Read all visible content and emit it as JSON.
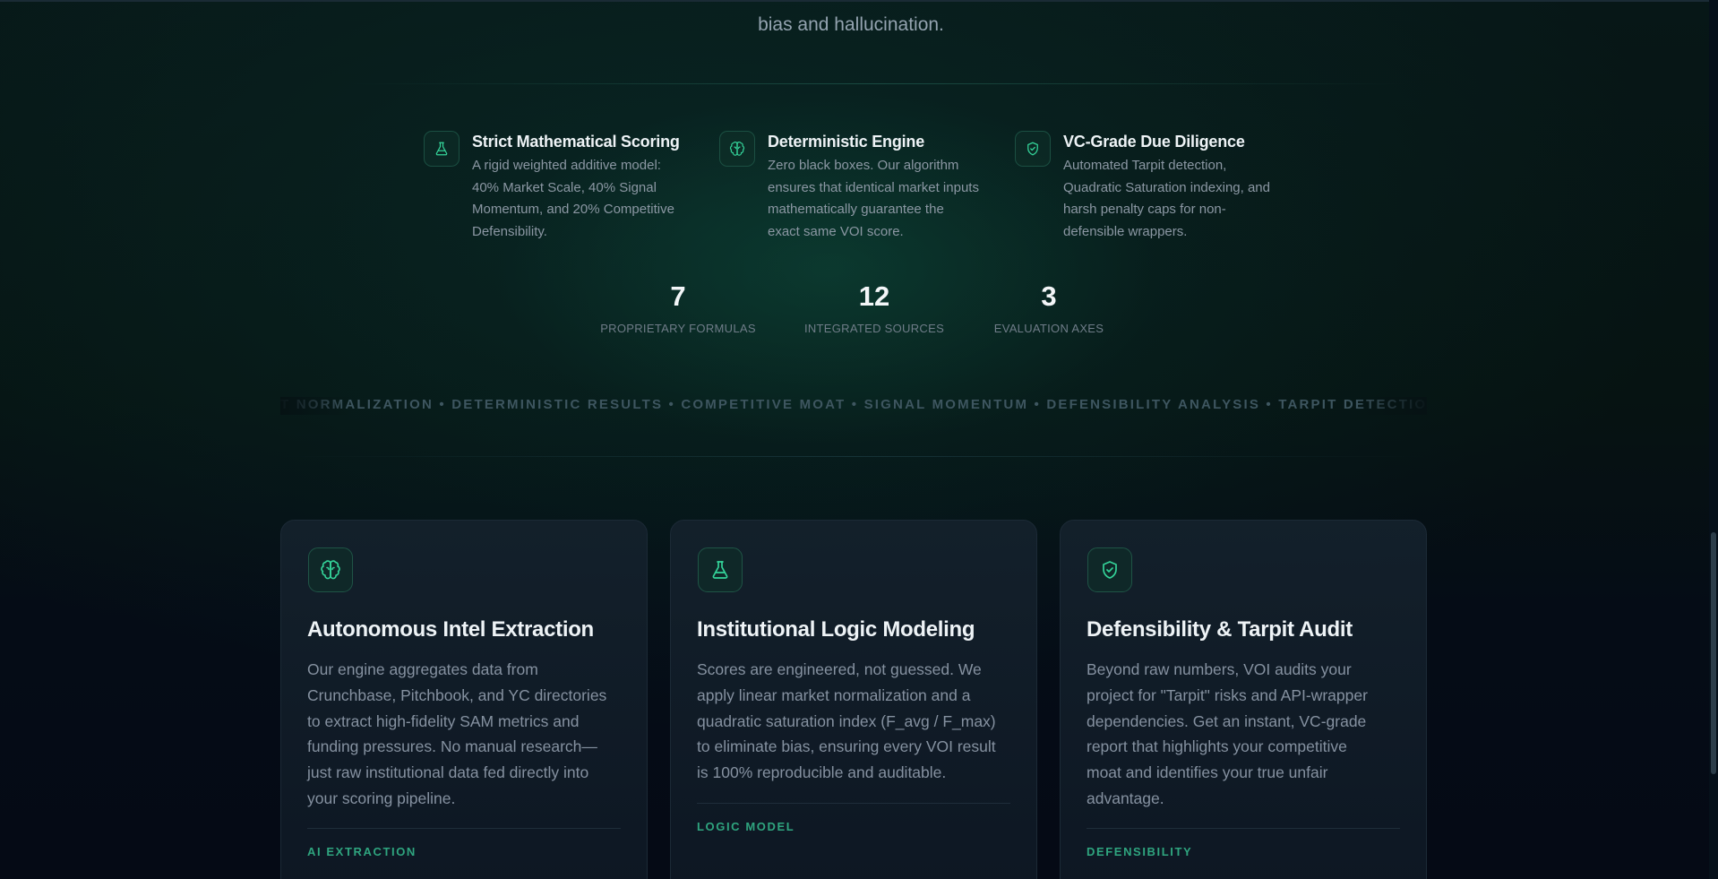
{
  "hero": {
    "lead_tail": "bias and hallucination."
  },
  "features": [
    {
      "icon": "flask-icon",
      "title": "Strict Mathematical Scoring",
      "desc_lines": [
        "A rigid weighted additive model:",
        "40% Market Scale, 40% Signal",
        "Momentum, and 20% Competitive",
        "Defensibility."
      ]
    },
    {
      "icon": "brain-icon",
      "title": "Deterministic Engine",
      "desc_lines": [
        "Zero black boxes. Our algorithm",
        "ensures that identical market inputs",
        "mathematically guarantee the",
        "exact same VOI score."
      ]
    },
    {
      "icon": "shield-check-icon",
      "title": "VC-Grade Due Diligence",
      "desc_lines": [
        "Automated Tarpit detection,",
        "Quadratic Saturation indexing, and",
        "harsh penalty caps for non-",
        "defensible wrappers."
      ]
    }
  ],
  "stats": [
    {
      "value": "7",
      "label": "PROPRIETARY FORMULAS"
    },
    {
      "value": "12",
      "label": "INTEGRATED SOURCES"
    },
    {
      "value": "3",
      "label": "EVALUATION AXES"
    }
  ],
  "marquee": {
    "text": "T NORMALIZATION • DETERMINISTIC RESULTS • COMPETITIVE MOAT • SIGNAL MOMENTUM • DEFENSIBILITY ANALYSIS • TARPIT DETECTION • AU"
  },
  "cards": [
    {
      "icon": "brain-icon",
      "title": "Autonomous Intel Extraction",
      "desc_lines": [
        "Our engine aggregates data from",
        "Crunchbase, Pitchbook, and YC directories",
        "to extract high-fidelity SAM metrics and",
        "funding pressures. No manual research—",
        "just raw institutional data fed directly into",
        "your scoring pipeline."
      ],
      "tag": "AI EXTRACTION"
    },
    {
      "icon": "flask-icon",
      "title": "Institutional Logic Modeling",
      "desc_lines": [
        "Scores are engineered, not guessed. We",
        "apply linear market normalization and a",
        "quadratic saturation index (F_avg / F_max)",
        "to eliminate bias, ensuring every VOI result",
        "is 100% reproducible and auditable."
      ],
      "tag": "LOGIC MODEL"
    },
    {
      "icon": "shield-check-icon",
      "title": "Defensibility & Tarpit Audit",
      "desc_lines": [
        "Beyond raw numbers, VOI audits your",
        "project for \"Tarpit\" risks and API-wrapper",
        "dependencies. Get an instant, VC-grade",
        "report that highlights your competitive",
        "moat and identifies your true unfair",
        "advantage."
      ],
      "tag": "DEFENSIBILITY"
    }
  ],
  "colors": {
    "accent": "#34d399",
    "tag": "#2fa57f",
    "background": "#050a14"
  }
}
